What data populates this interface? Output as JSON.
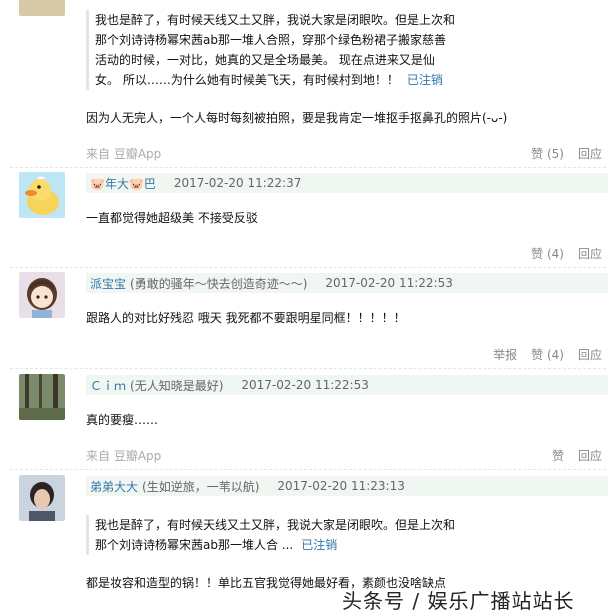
{
  "comments": [
    {
      "quote": [
        "我也是醉了，有时候天线又土又胖，我说大家是闭眼吹。但是上次和",
        "那个刘诗诗杨幂宋茜ab那一堆人合照，穿那个绿色粉裙子搬家慈善",
        "活动的时候，一对比，她真的又是全场最美。 现在点进来又是仙",
        "女。 所以……为什么她有时候美飞天，有时候村到地！！"
      ],
      "quote_link": "已注销",
      "text": "因为人无完人，一个人每时每刻被拍照，要是我肯定一堆抠手抠鼻孔的照片(-ᴗ-)",
      "source": "来自 豆瓣App",
      "likes": "赞 (5)",
      "reply": "回应"
    },
    {
      "user": "🐷年大🐷巴",
      "time": "2017-02-20 11:22:37",
      "text": "一直都觉得她超级美 不接受反驳",
      "likes": "赞 (4)",
      "reply": "回应"
    },
    {
      "user": "派宝宝",
      "signature": "(勇敢的骚年～快去创造奇迹～～)",
      "time": "2017-02-20 11:22:53",
      "text": "跟路人的对比好残忍 哦天 我死都不要跟明星同框！！！！！",
      "report": "举报",
      "likes": "赞 (4)",
      "reply": "回应"
    },
    {
      "user": "Ｃｉｍ",
      "signature": "(无人知晓是最好)",
      "time": "2017-02-20 11:22:53",
      "text": "真的要瘦……",
      "source": "来自 豆瓣App",
      "likes": "赞",
      "reply": "回应"
    },
    {
      "user": "弟弟大大",
      "signature": "(生如逆旅，一苇以航)",
      "time": "2017-02-20 11:23:13",
      "quote": [
        "我也是醉了，有时候天线又土又胖，我说大家是闭眼吹。但是上次和",
        "那个刘诗诗杨幂宋茜ab那一堆人合 ..."
      ],
      "quote_link": "已注销",
      "text": "都是妆容和造型的锅！！单比五官我觉得她最好看，素颜也没啥缺点"
    }
  ],
  "watermark": "头条号 / 娱乐广播站站长",
  "colors": {
    "link": "#3377aa",
    "header_bg": "#f0f6f2",
    "muted": "#888888"
  }
}
